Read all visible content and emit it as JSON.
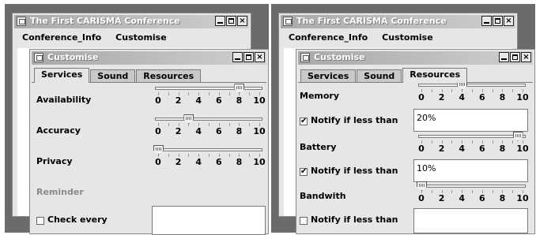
{
  "left": {
    "main_title": "The First CARISMA Conference",
    "menu": [
      "Conference_Info",
      "Customise"
    ],
    "dialog_title": "Customise",
    "tabs": [
      "Services",
      "Sound",
      "Resources"
    ],
    "active_tab": "Services",
    "sliders": [
      {
        "label": "Availability",
        "value": 8
      },
      {
        "label": "Accuracy",
        "value": 3
      },
      {
        "label": "Privacy",
        "value": 0
      }
    ],
    "reminder_label": "Reminder",
    "check_every_label": "Check every",
    "check_every_checked": false,
    "check_every_value": ""
  },
  "right": {
    "main_title": "The First CARISMA Conference",
    "menu": [
      "Conference_Info",
      "Customise"
    ],
    "dialog_title": "Customise",
    "tabs": [
      "Services",
      "Sound",
      "Resources"
    ],
    "active_tab": "Resources",
    "resources": [
      {
        "label": "Memory",
        "value": 4,
        "notify_label": "Notify if less than",
        "notify_checked": true,
        "threshold": "20%"
      },
      {
        "label": "Battery",
        "value": 9.5,
        "notify_label": "Notify if less than",
        "notify_checked": true,
        "threshold": "10%"
      },
      {
        "label": "Bandwith",
        "value": 0,
        "notify_label": "Notify if less than",
        "notify_checked": false,
        "threshold": ""
      }
    ]
  },
  "slider_scale": {
    "min": 0,
    "max": 10,
    "labels": [
      "0",
      "2",
      "4",
      "6",
      "8",
      "10"
    ]
  },
  "check_mark": "✔"
}
